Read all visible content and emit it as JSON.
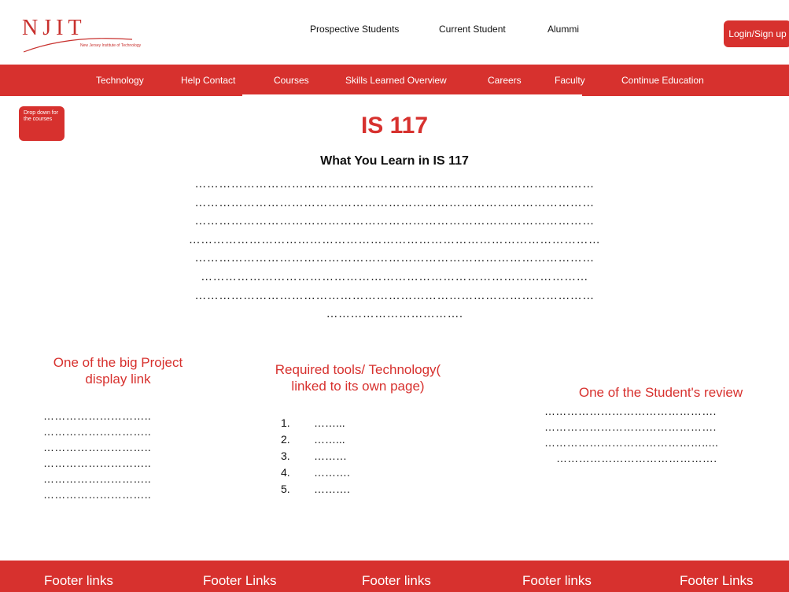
{
  "logo": {
    "mark": "NJIT",
    "subtitle": "New Jersey Institute of Technology"
  },
  "top_nav": {
    "prospective": "Prospective Students",
    "current": "Current Student",
    "alumni": "Alummi",
    "login": "Login/Sign up"
  },
  "nav": {
    "items": [
      "Technology",
      "Help Contact",
      "Courses",
      "Skills Learned Overview",
      "Careers",
      "Faculty",
      "Continue Education"
    ]
  },
  "dropdown": {
    "label": "Drop down for the courses"
  },
  "page": {
    "title": "IS 117",
    "subtitle": "What You Learn in IS 117"
  },
  "description_lines": [
    "………………………………………………………………………………………",
    "………………………………………………………………………………………",
    "………………………………………………………………………………………",
    "…………………………………………………………………………………………",
    "………………………………………………………………………………………",
    "……………………………………………………………………………………",
    "………………………………………………………………………………………",
    "……………………………."
  ],
  "project": {
    "title": "One of the big Project display link",
    "lines": [
      "………………………..",
      "………………………..",
      "………………………..",
      "………………………..",
      "………………………..",
      "……………………….."
    ]
  },
  "tools": {
    "title": "Required tools/ Technology( linked to its own page)",
    "items": [
      {
        "num": "1.",
        "text": "……..."
      },
      {
        "num": "2.",
        "text": "……..."
      },
      {
        "num": "3.",
        "text": "………"
      },
      {
        "num": "4.",
        "text": "………."
      },
      {
        "num": "5.",
        "text": "………."
      }
    ]
  },
  "review": {
    "title": "One of the Student's review",
    "lines": [
      "……………………………………….",
      "……………………………………….",
      "…………………………………….....",
      "……………………………………."
    ]
  },
  "footer": {
    "links": [
      "Footer links",
      "Footer Links",
      "Footer links",
      "Footer links",
      "Footer Links"
    ]
  },
  "colors": {
    "brand_red": "#d7312e"
  }
}
